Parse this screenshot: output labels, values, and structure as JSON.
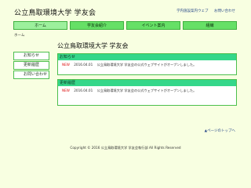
{
  "site": {
    "title": "公立鳥取環境大学 学友会"
  },
  "utility": {
    "links": [
      "学内施設案内ウェブ",
      "お問い合わせ"
    ]
  },
  "nav": {
    "tabs": [
      "ホーム",
      "学友会紹介",
      "イベント案内",
      "組織"
    ]
  },
  "breadcrumb": "ホーム",
  "sidebar": {
    "items": [
      "お知らせ",
      "更新履歴",
      "お問い合わせ"
    ]
  },
  "main": {
    "title": "公立鳥取環境大学 学友会",
    "news": {
      "header": "お知らせ",
      "entries": [
        {
          "badge": "NEW",
          "date": "2016.04.01",
          "text": "公立鳥取環境大学 学友会の公式ウェブサイトがオープンしました。"
        }
      ]
    },
    "updates": {
      "header": "更新履歴",
      "entries": [
        {
          "badge": "NEW",
          "date": "2016.04.01",
          "text": "公立鳥取環境大学 学友会の公式ウェブサイトがオープンしました。"
        }
      ]
    }
  },
  "page_top": "▲ページのトップへ",
  "footer": "Copyright © 2016 公立鳥取環境大学 学友会執行部 All Rights Reserved",
  "colors": {
    "background": "#f8ffe1",
    "nav_tab": "#66e066",
    "box_header": "#35d78a",
    "border": "#4cbf4c",
    "new_badge": "#dd1111"
  }
}
